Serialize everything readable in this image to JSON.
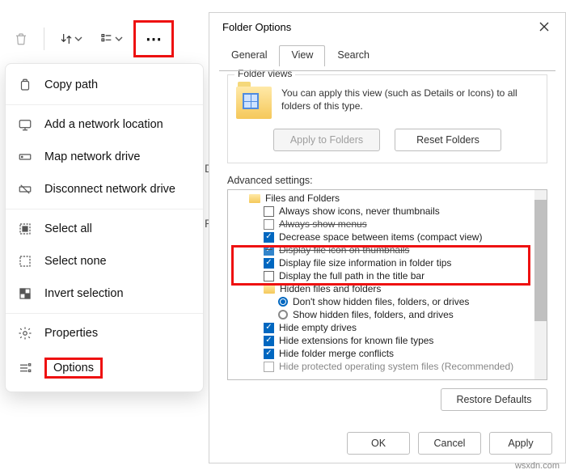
{
  "toolbar": {
    "more_glyph": "⋯"
  },
  "menu": {
    "copy_path": "Copy path",
    "add_network": "Add a network location",
    "map_drive": "Map network drive",
    "disconnect_drive": "Disconnect network drive",
    "select_all": "Select all",
    "select_none": "Select none",
    "invert_selection": "Invert selection",
    "properties": "Properties",
    "options": "Options"
  },
  "bg": {
    "d": "D",
    "p": "P"
  },
  "dialog": {
    "title": "Folder Options",
    "tabs": {
      "general": "General",
      "view": "View",
      "search": "Search"
    },
    "folder_views": {
      "group_label": "Folder views",
      "text": "You can apply this view (such as Details or Icons) to all folders of this type.",
      "apply": "Apply to Folders",
      "reset": "Reset Folders"
    },
    "advanced_label": "Advanced settings:",
    "tree": {
      "files_folders": "Files and Folders",
      "always_icons": "Always show icons, never thumbnails",
      "always_menus": "Always show menus",
      "compact": "Decrease space between items (compact view)",
      "thumb_icon": "Display file icon on thumbnails",
      "size_tips": "Display file size information in folder tips",
      "full_path": "Display the full path in the title bar",
      "hidden_group": "Hidden files and folders",
      "hidden_no": "Don't show hidden files, folders, or drives",
      "hidden_yes": "Show hidden files, folders, and drives",
      "hide_empty": "Hide empty drives",
      "hide_ext": "Hide extensions for known file types",
      "hide_merge": "Hide folder merge conflicts",
      "hide_protected": "Hide protected operating system files (Recommended)"
    },
    "restore": "Restore Defaults",
    "ok": "OK",
    "cancel": "Cancel",
    "apply": "Apply"
  },
  "watermark": "wsxdn.com"
}
